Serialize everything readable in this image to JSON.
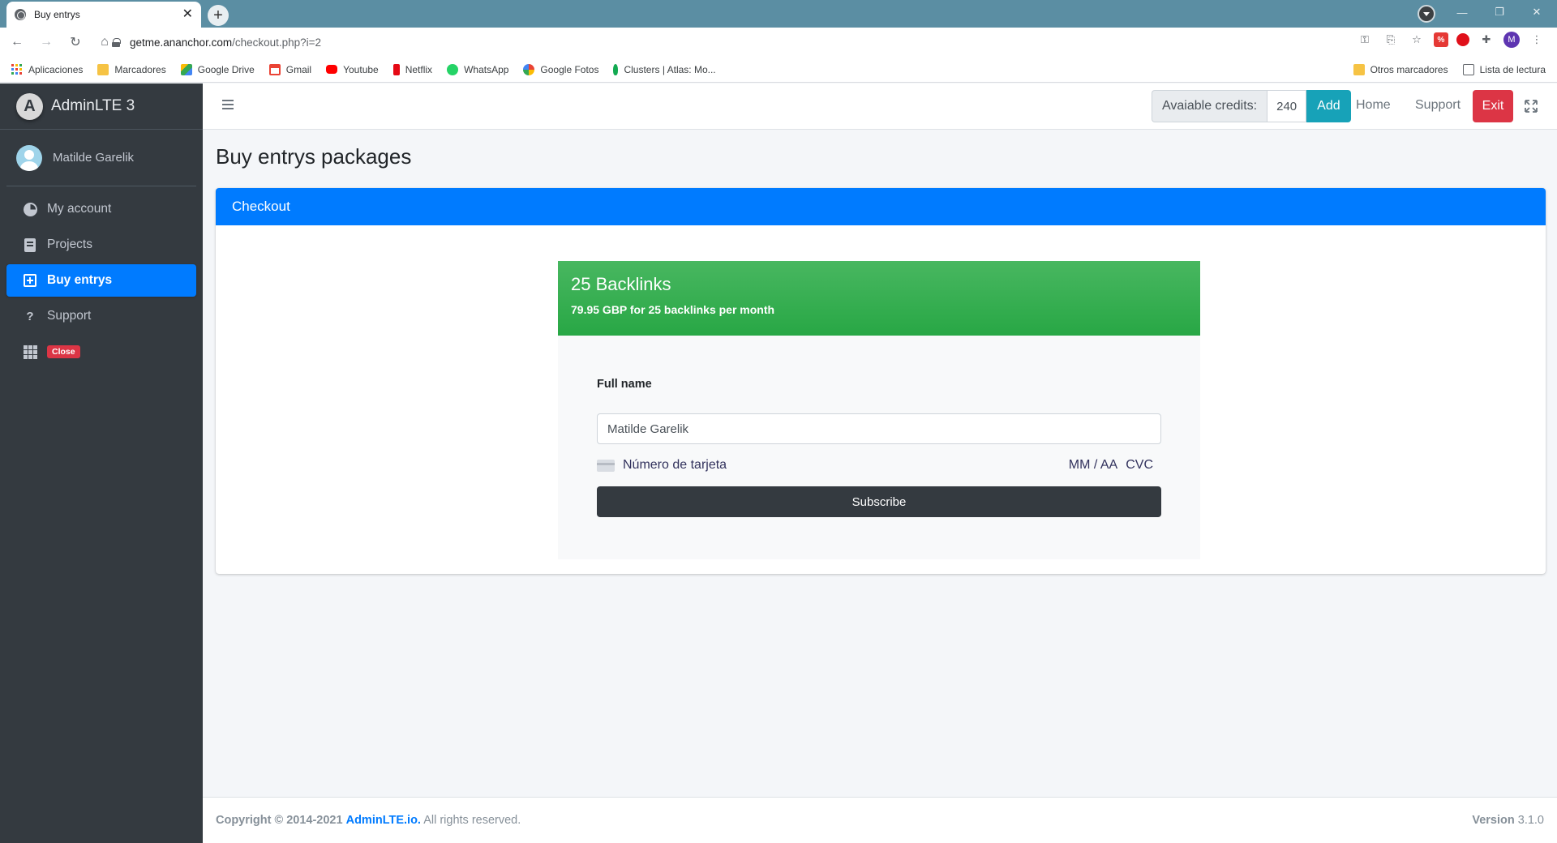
{
  "browser": {
    "tab_title": "Buy entrys",
    "url_host": "getme.ananchor.com",
    "url_path": "/checkout.php?i=2",
    "profile_initial": "M",
    "bookmarks": [
      {
        "label": "Aplicaciones",
        "icon": "apps-icon"
      },
      {
        "label": "Marcadores",
        "icon": "folder-icon"
      },
      {
        "label": "Google Drive",
        "icon": "drive-icon"
      },
      {
        "label": "Gmail",
        "icon": "gmail-icon"
      },
      {
        "label": "Youtube",
        "icon": "youtube-icon"
      },
      {
        "label": "Netflix",
        "icon": "netflix-icon"
      },
      {
        "label": "WhatsApp",
        "icon": "whatsapp-icon"
      },
      {
        "label": "Google Fotos",
        "icon": "photos-icon"
      },
      {
        "label": "Clusters | Atlas: Mo...",
        "icon": "mongodb-icon"
      }
    ],
    "bookmarks_right": {
      "other": "Otros marcadores",
      "reading": "Lista de lectura"
    }
  },
  "sidebar": {
    "brand": "AdminLTE 3",
    "user_name": "Matilde Garelik",
    "items": [
      {
        "label": "My account",
        "icon": "pie-chart-icon",
        "active": false
      },
      {
        "label": "Projects",
        "icon": "book-icon",
        "active": false
      },
      {
        "label": "Buy entrys",
        "icon": "plus-square-icon",
        "active": true
      },
      {
        "label": "Support",
        "icon": "question-icon",
        "active": false
      }
    ],
    "close_badge": "Close"
  },
  "navbar": {
    "credits_label": "Avaiable credits:",
    "credits_value": "240",
    "add_label": "Add",
    "home_label": "Home",
    "support_label": "Support",
    "exit_label": "Exit"
  },
  "main": {
    "page_title": "Buy entrys packages",
    "card_title": "Checkout",
    "plan": {
      "name": "25 Backlinks",
      "description": "79.95 GBP for 25 backlinks per month"
    },
    "form": {
      "full_name_label": "Full name",
      "full_name_value": "Matilde Garelik",
      "card_number_placeholder": "Número de tarjeta",
      "expiry_placeholder": "MM / AA",
      "cvc_placeholder": "CVC",
      "subscribe_label": "Subscribe"
    }
  },
  "footer": {
    "copyright_prefix": "Copyright © 2014-2021",
    "link_text": "AdminLTE.io.",
    "rights": "All rights reserved.",
    "version_label": "Version",
    "version_value": "3.1.0"
  },
  "colors": {
    "primary": "#007bff",
    "success": "#28a745",
    "danger": "#dc3545",
    "info": "#17a2b8",
    "sidebar": "#343a40"
  }
}
